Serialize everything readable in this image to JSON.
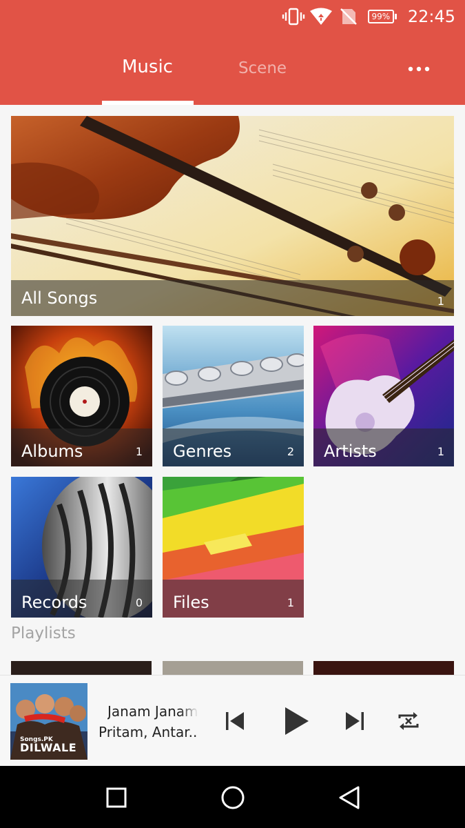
{
  "status_bar": {
    "battery": "99%",
    "time": "22:45",
    "icons": [
      "vibrate-icon",
      "wifi-icon",
      "no-sim-icon",
      "battery-icon"
    ]
  },
  "tabs": [
    {
      "label": "Music",
      "active": true
    },
    {
      "label": "Scene",
      "active": false
    }
  ],
  "menu_icon": "more-dots-icon",
  "library": {
    "all_songs": {
      "label": "All Songs",
      "count": "1"
    },
    "albums": {
      "label": "Albums",
      "count": "1"
    },
    "genres": {
      "label": "Genres",
      "count": "2"
    },
    "artists": {
      "label": "Artists",
      "count": "1"
    },
    "records": {
      "label": "Records",
      "count": "0"
    },
    "files": {
      "label": "Files",
      "count": "1"
    }
  },
  "playlists": {
    "title": "Playlists"
  },
  "now_playing": {
    "title": "Janam Janam",
    "artist": "Pritam, Antar..",
    "cover_text": "Songs.PK",
    "cover_logo": "DILWALE",
    "controls": [
      "previous-icon",
      "play-icon",
      "next-icon",
      "repeat-icon"
    ]
  },
  "nav": [
    "recents-icon",
    "home-icon",
    "back-icon"
  ],
  "colors": {
    "accent": "#e15346",
    "background": "#f6f6f6",
    "player_icons": "#333333"
  }
}
